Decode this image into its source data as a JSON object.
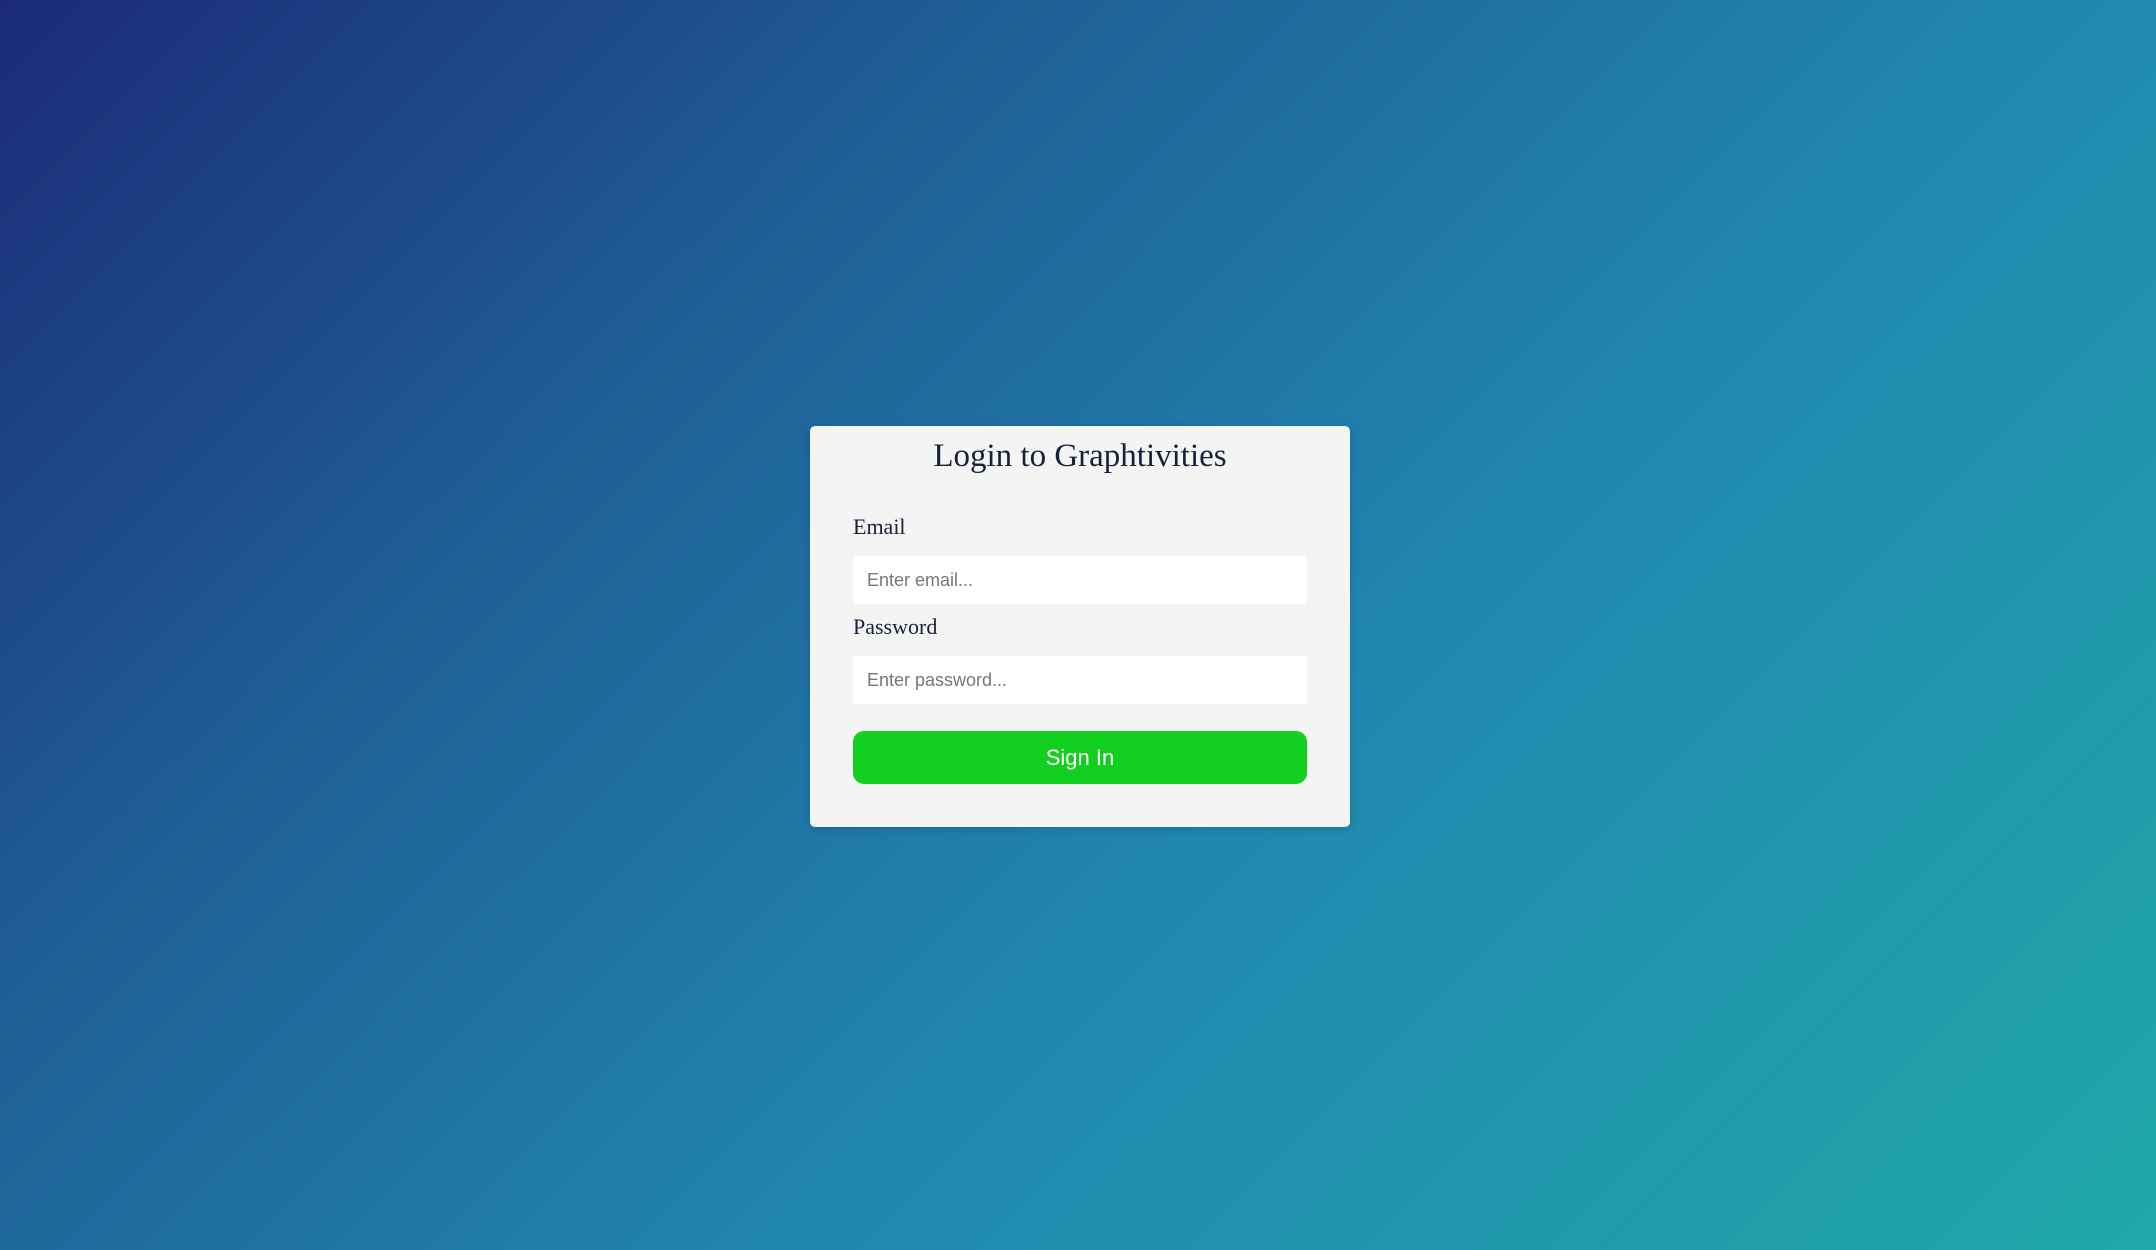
{
  "colors": {
    "background_start": "#1b2a78",
    "background_end": "#20a8a8",
    "card_background": "#f4f4f4",
    "button_green": "#13cf1f",
    "text_dark": "#16213a"
  },
  "login": {
    "title": "Login to Graphtivities",
    "email": {
      "label": "Email",
      "placeholder": "Enter email...",
      "value": ""
    },
    "password": {
      "label": "Password",
      "placeholder": "Enter password...",
      "value": ""
    },
    "submit_label": "Sign In"
  }
}
